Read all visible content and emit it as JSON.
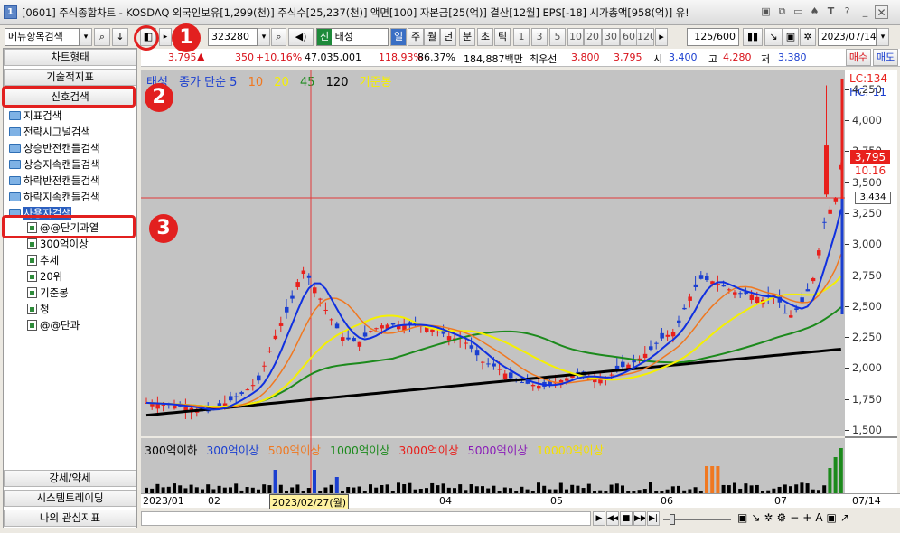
{
  "window": {
    "badge": "1",
    "title": "[0601] 주식종합차트 - KOSDAQ 외국인보유[1,299(천)] 주식수[25,237(천)] 액면[100] 자본금[25(억)] 결산[12월] EPS[-18] 시가총액[958(억)] 유!"
  },
  "toolbar": {
    "menu_search": "메뉴항목검색",
    "code": "323280",
    "tag": "신",
    "name": "태성",
    "periods": [
      "일",
      "주",
      "월",
      "년",
      "분",
      "초",
      "틱"
    ],
    "intervals": [
      "1",
      "3",
      "5",
      "10",
      "20",
      "30",
      "60",
      "120"
    ],
    "count": "125/600",
    "date": "2023/07/14"
  },
  "quote": {
    "price": "3,795",
    "arrow": "▲",
    "change": "350",
    "change_pct": "+10.16%",
    "volume": "47,035,001",
    "vol_ratio": "118.93%",
    "turnover": "86.37%",
    "mcap": "184,887백만",
    "pre_label": "최우선",
    "ask": "3,800",
    "bid": "3,795",
    "open_label": "시",
    "open": "3,400",
    "high_label": "고",
    "high": "4,280",
    "low_label": "저",
    "low": "3,380",
    "buy": "매수",
    "sell": "매도"
  },
  "left_panel": {
    "buttons": [
      "차트형태",
      "기술적지표",
      "신호검색"
    ],
    "tree": [
      "지표검색",
      "전략시그널검색",
      "상승반전캔들검색",
      "상승지속캔들검색",
      "하락반전캔들검색",
      "하락지속캔들검색",
      "사용자검색"
    ],
    "sub": [
      "@@단기과열",
      "300억이상",
      "추세",
      "20위",
      "기준봉",
      "청",
      "@@단과"
    ],
    "bottom": [
      "강세/약세",
      "시스템트레이딩",
      "나의 관심지표"
    ]
  },
  "legend": {
    "name": "태성",
    "ma": "종가 단순 5",
    "p10": "10",
    "p20": "20",
    "p45": "45",
    "p120": "120",
    "std": "기준봉"
  },
  "vol_legend": [
    "300억이하",
    "300억이상",
    "500억이상",
    "1000억이상",
    "3000억이상",
    "5000억이상",
    "10000억이상"
  ],
  "axis": {
    "ticks": [
      "4,250",
      "4,000",
      "3,750",
      "3,500",
      "3,250",
      "3,000",
      "2,750",
      "2,500",
      "2,250",
      "2,000",
      "1,750",
      "1,500"
    ],
    "lc": "LC:134",
    "hc": "HC:-11",
    "last": "3,795",
    "pct": "10.16",
    "cross": "3,434"
  },
  "xaxis": {
    "labels": [
      "2023/01",
      "02",
      "04",
      "05",
      "06",
      "07",
      "07/14"
    ],
    "cursor": "2023/02/27(월)"
  },
  "markers": [
    "1",
    "2",
    "3"
  ],
  "colors": {
    "up": "#e8201c",
    "down": "#1b3fd0",
    "ma5": "#1030e0",
    "ma10": "#f07820",
    "ma20": "#f5f000",
    "ma45": "#1c8a1c",
    "ma120": "#000000"
  }
}
